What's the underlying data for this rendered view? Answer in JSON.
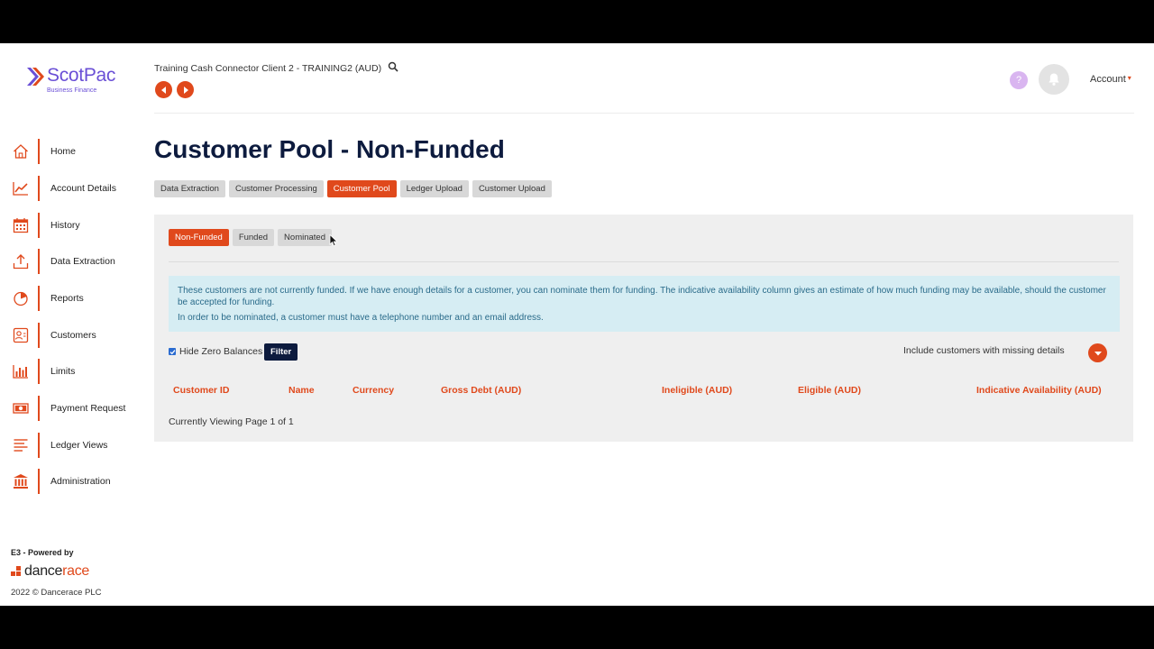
{
  "brand": {
    "name": "ScotPac",
    "tagline": "Business Finance",
    "accent": "#e0491c",
    "logo_color": "#6a4fd6",
    "navy": "#0d1b3e"
  },
  "header": {
    "client_name": "Training Cash Connector Client 2 - TRAINING2 (AUD)",
    "help_label": "?",
    "account_label": "Account"
  },
  "sidebar": {
    "items": [
      {
        "label": "Home",
        "icon": "home-icon"
      },
      {
        "label": "Account Details",
        "icon": "chart-line-icon"
      },
      {
        "label": "History",
        "icon": "calendar-icon"
      },
      {
        "label": "Data Extraction",
        "icon": "upload-icon"
      },
      {
        "label": "Reports",
        "icon": "pie-chart-icon"
      },
      {
        "label": "Customers",
        "icon": "contact-card-icon"
      },
      {
        "label": "Limits",
        "icon": "bar-chart-icon"
      },
      {
        "label": "Payment Request",
        "icon": "money-icon"
      },
      {
        "label": "Ledger Views",
        "icon": "lines-icon"
      },
      {
        "label": "Administration",
        "icon": "bank-icon"
      }
    ]
  },
  "footer": {
    "powered_by": "E3 - Powered by",
    "logo_dance": "dance",
    "logo_race": "race",
    "copyright": "2022 © Dancerace PLC"
  },
  "main": {
    "title": "Customer Pool - Non-Funded",
    "tabs": [
      {
        "label": "Data Extraction",
        "active": false
      },
      {
        "label": "Customer Processing",
        "active": false
      },
      {
        "label": "Customer Pool",
        "active": true
      },
      {
        "label": "Ledger Upload",
        "active": false
      },
      {
        "label": "Customer Upload",
        "active": false
      }
    ],
    "subtabs": [
      {
        "label": "Non-Funded",
        "active": true
      },
      {
        "label": "Funded",
        "active": false
      },
      {
        "label": "Nominated",
        "active": false
      }
    ],
    "info_line_1": "These customers are not currently funded. If we have enough details for a customer, you can nominate them for funding. The indicative availability column gives an estimate of how much funding may be available, should the customer be accepted for funding.",
    "info_line_2": "In order to be nominated, a customer must have a telephone number and an email address.",
    "hide_zero_label": "Hide Zero Balances",
    "hide_zero_checked": true,
    "filter_label": "Filter",
    "missing_details_label": "Include customers with missing details",
    "columns": [
      "Customer ID",
      "Name",
      "Currency",
      "Gross Debt (AUD)",
      "Ineligible (AUD)",
      "Eligible (AUD)",
      "Indicative Availability (AUD)"
    ],
    "pager_text": "Currently Viewing Page 1 of 1"
  }
}
